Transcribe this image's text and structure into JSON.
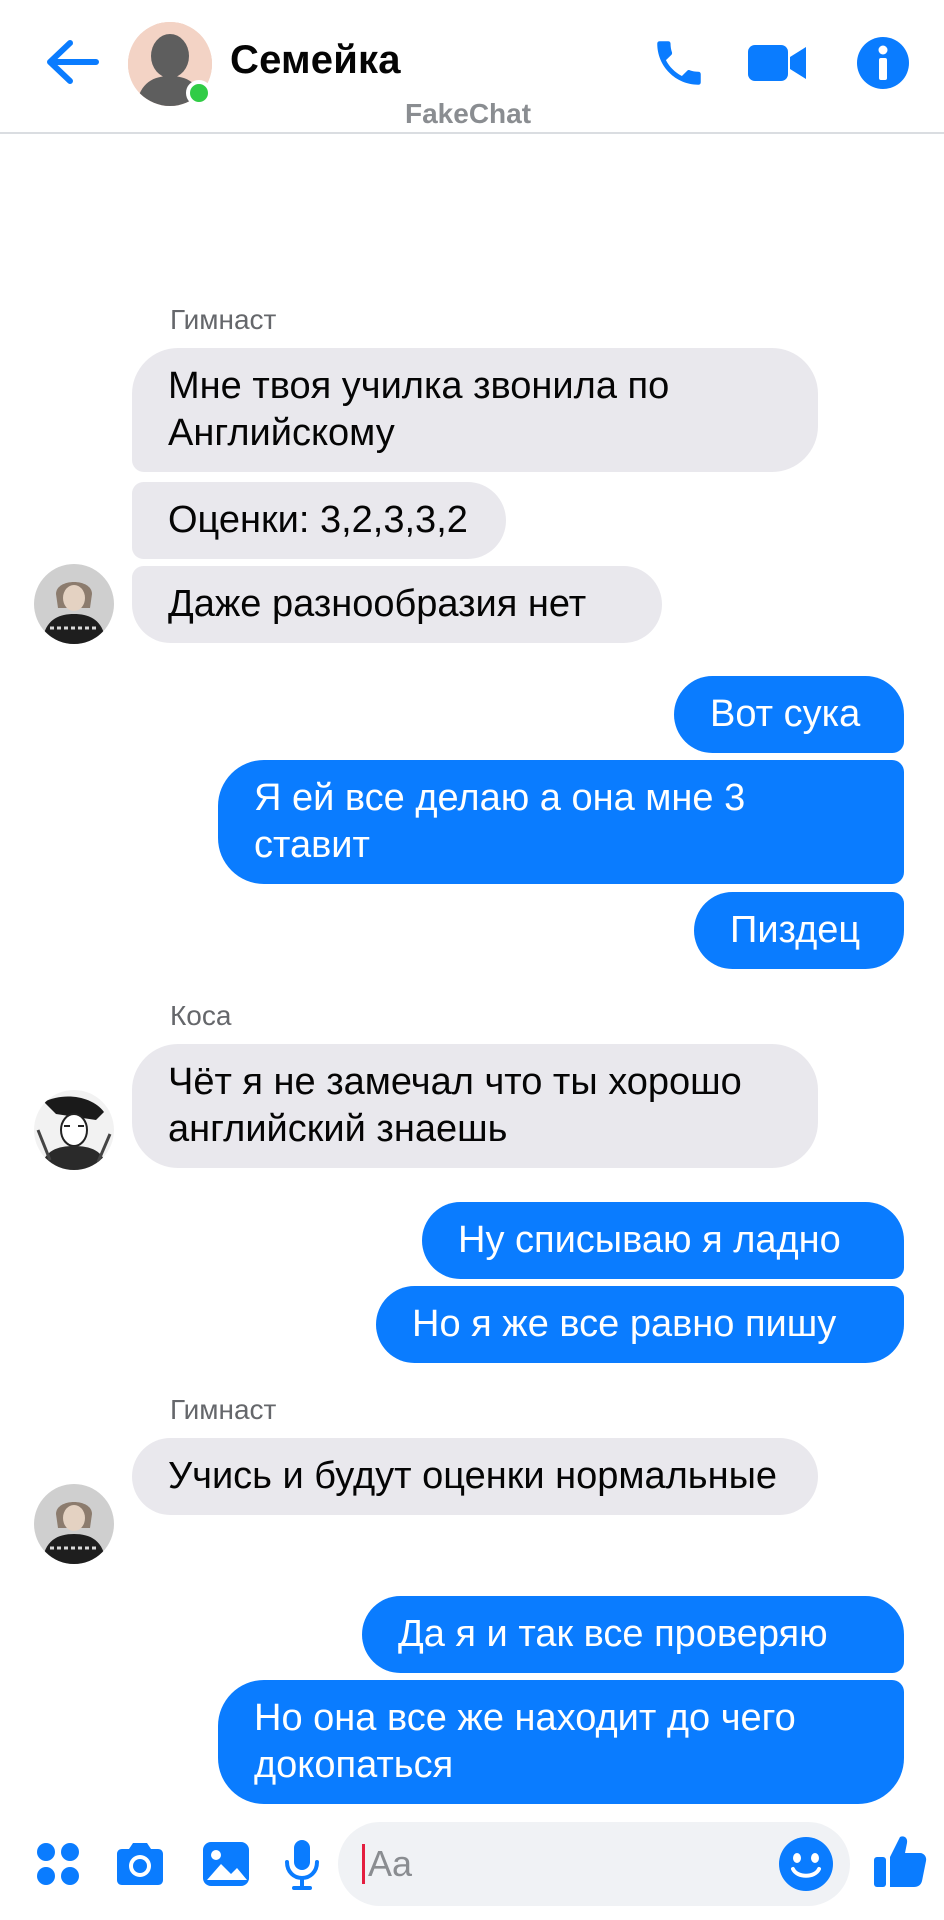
{
  "header": {
    "title": "Семейка",
    "watermark": "FakeChat",
    "icons": [
      "back-arrow-icon",
      "phone-icon",
      "video-camera-icon",
      "info-icon"
    ],
    "accent_color": "#0a7cff",
    "online_color": "#31cc46"
  },
  "messages": [
    {
      "sender": "Гимнаст",
      "direction": "in",
      "texts": [
        "Мне твоя училка звонила по Английскому",
        "Оценки: 3,2,3,3,2",
        "Даже разнообразия нет"
      ]
    },
    {
      "direction": "out",
      "texts": [
        "Вот сука",
        "Я ей все делаю а она мне 3 ставит",
        "Пиздец"
      ]
    },
    {
      "sender": "Коса",
      "direction": "in",
      "texts": [
        "Чёт я не замечал что ты хорошо английский знаешь"
      ]
    },
    {
      "direction": "out",
      "texts": [
        "Ну списываю я ладно",
        "Но я же все равно пишу"
      ]
    },
    {
      "sender": "Гимнаст",
      "direction": "in",
      "texts": [
        "Учись и будут оценки нормальные"
      ]
    },
    {
      "direction": "out",
      "texts": [
        "Да я и так все проверяю",
        "Но она все же находит до чего докопаться"
      ]
    }
  ],
  "composer": {
    "placeholder": "Aa",
    "icons": [
      "apps-grid-icon",
      "camera-icon",
      "image-icon",
      "microphone-icon",
      "emoji-icon",
      "thumbs-up-icon"
    ]
  }
}
